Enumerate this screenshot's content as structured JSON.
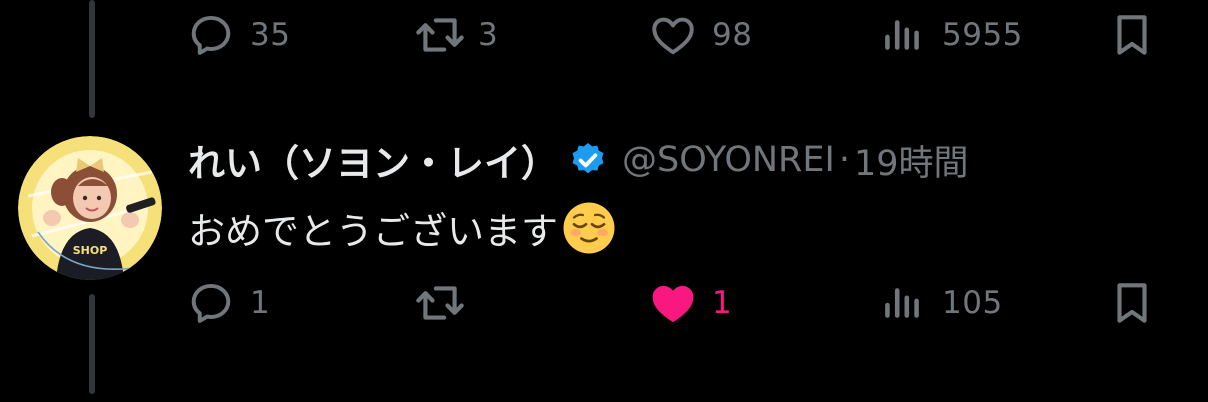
{
  "colors": {
    "background": "#000000",
    "text_primary": "#e7e9ea",
    "text_secondary": "#71767b",
    "like_active": "#f91880",
    "verified": "#1d9bf0",
    "thread_line": "#333639"
  },
  "previous_post": {
    "actions": {
      "replies": "35",
      "reposts": "3",
      "likes": "98",
      "views": "5955"
    }
  },
  "reply_post": {
    "author": {
      "display_name": "れい（ソヨン・レイ）",
      "handle": "@SOYONREI",
      "verified": true,
      "avatar_signature": "Risa Furusawa"
    },
    "separator": "·",
    "timestamp": "19時間",
    "text": "おめでとうございます",
    "emoji": "relieved-face",
    "actions": {
      "replies": "1",
      "reposts": "",
      "likes": "1",
      "liked": true,
      "views": "105"
    }
  }
}
